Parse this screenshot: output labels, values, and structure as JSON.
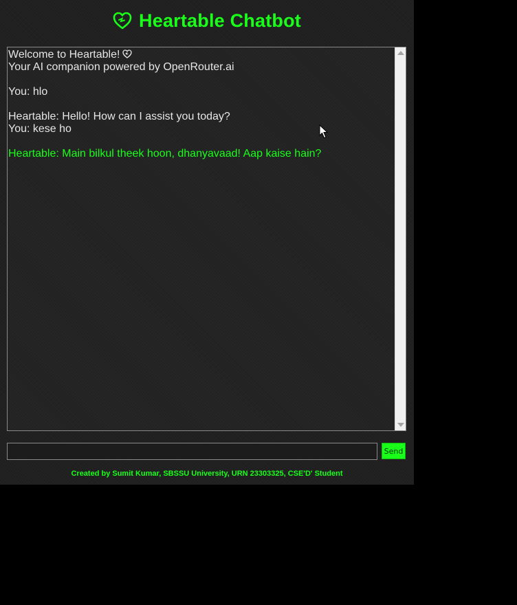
{
  "header": {
    "title": "Heartable Chatbot",
    "icon": "heart-icon"
  },
  "chat": {
    "lines": [
      {
        "text": "Welcome to Heartable!",
        "icon": "heart-icon",
        "style": "system"
      },
      {
        "text": "Your AI companion powered by OpenRouter.ai",
        "style": "system"
      },
      {
        "text": "",
        "style": "gap"
      },
      {
        "text": "You: hlo",
        "style": "user"
      },
      {
        "text": "",
        "style": "gap"
      },
      {
        "text": "Heartable: Hello! How can I assist you today?",
        "style": "bot"
      },
      {
        "text": "You: kese ho",
        "style": "user"
      },
      {
        "text": "",
        "style": "gap"
      },
      {
        "text": "Heartable: Main bilkul theek hoon, dhanyavaad! Aap kaise hain?",
        "style": "bot-latest"
      }
    ]
  },
  "input": {
    "value": "",
    "placeholder": ""
  },
  "send_button": {
    "label": "Send"
  },
  "footer": {
    "text": "Created by Sumit Kumar, SBSSU University, URN 23303325, CSE'D' Student"
  },
  "colors": {
    "accent": "#1aff1a",
    "background": "#1f1f1f",
    "page_background": "#000000",
    "text": "#e6e6e6"
  }
}
